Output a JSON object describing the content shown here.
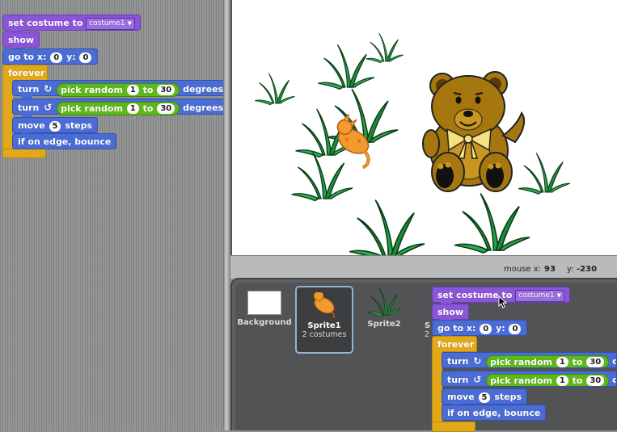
{
  "script": {
    "set_costume": "set costume to",
    "costume_value": "costume1",
    "show": "show",
    "go_to_x": "go to x:",
    "x_value": "0",
    "y_label": "y:",
    "y_value": "0",
    "forever": "forever",
    "turn": "turn",
    "pick_random": "pick random",
    "random_from": "1",
    "to": "to",
    "random_to": "30",
    "degrees": "degrees",
    "move": "move",
    "steps_value": "5",
    "steps": "steps",
    "bounce": "if on edge, bounce"
  },
  "script_panel": {
    "degrees": "deg"
  },
  "stage_footer": {
    "mouse_x_label": "mouse x:",
    "mouse_x_value": "93",
    "mouse_y_label": "y:",
    "mouse_y_value": "-230"
  },
  "sprites": {
    "background": {
      "name": "Background"
    },
    "sprite1": {
      "name": "Sprite1",
      "sub": "2 costumes"
    },
    "sprite2": {
      "name": "Sprite2"
    },
    "partial": {
      "name": "S",
      "sub": "2"
    }
  },
  "colors": {
    "looks": "#8a55d7",
    "motion": "#4a6cd4",
    "control": "#e1a91a",
    "operators": "#5fb81b"
  },
  "icons": [
    "rotate-right-icon",
    "rotate-left-icon",
    "dropdown-arrow-icon",
    "mouse-cursor-icon"
  ]
}
